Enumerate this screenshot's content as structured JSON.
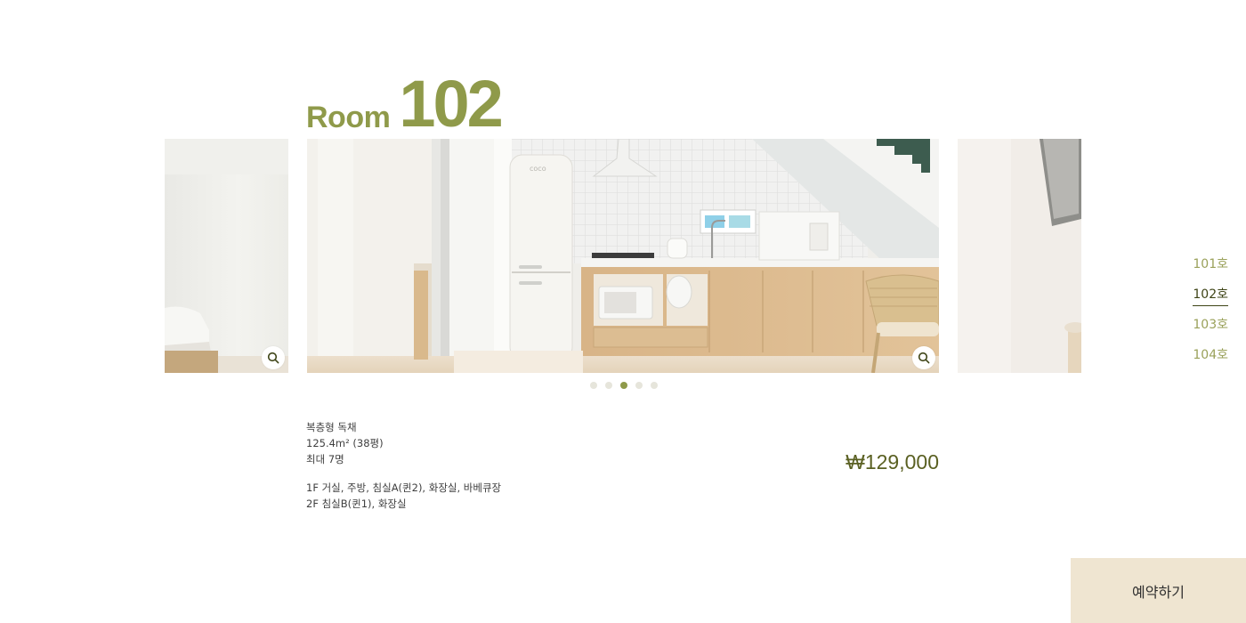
{
  "room": {
    "title_word": "Room",
    "title_number": "102"
  },
  "gallery": {
    "slide_count": 5,
    "active_index": 2,
    "zoom_icon": "search-icon"
  },
  "details": {
    "type": "복층형 독채",
    "area": "125.4m² (38평)",
    "capacity": "최대 7명",
    "floor1": "1F 거실, 주방, 침실A(퀸2), 화장실, 바베큐장",
    "floor2": "2F 침실B(퀸1), 화장실"
  },
  "price": "₩129,000",
  "room_nav": [
    {
      "label": "101호",
      "active": false
    },
    {
      "label": "102호",
      "active": true
    },
    {
      "label": "103호",
      "active": false
    },
    {
      "label": "104호",
      "active": false
    }
  ],
  "booking": {
    "label": "예약하기"
  },
  "colors": {
    "accent": "#8f9a4a",
    "accent_dark": "#3e4416",
    "price": "#5a6022",
    "booking_bg": "#efe5d1"
  }
}
